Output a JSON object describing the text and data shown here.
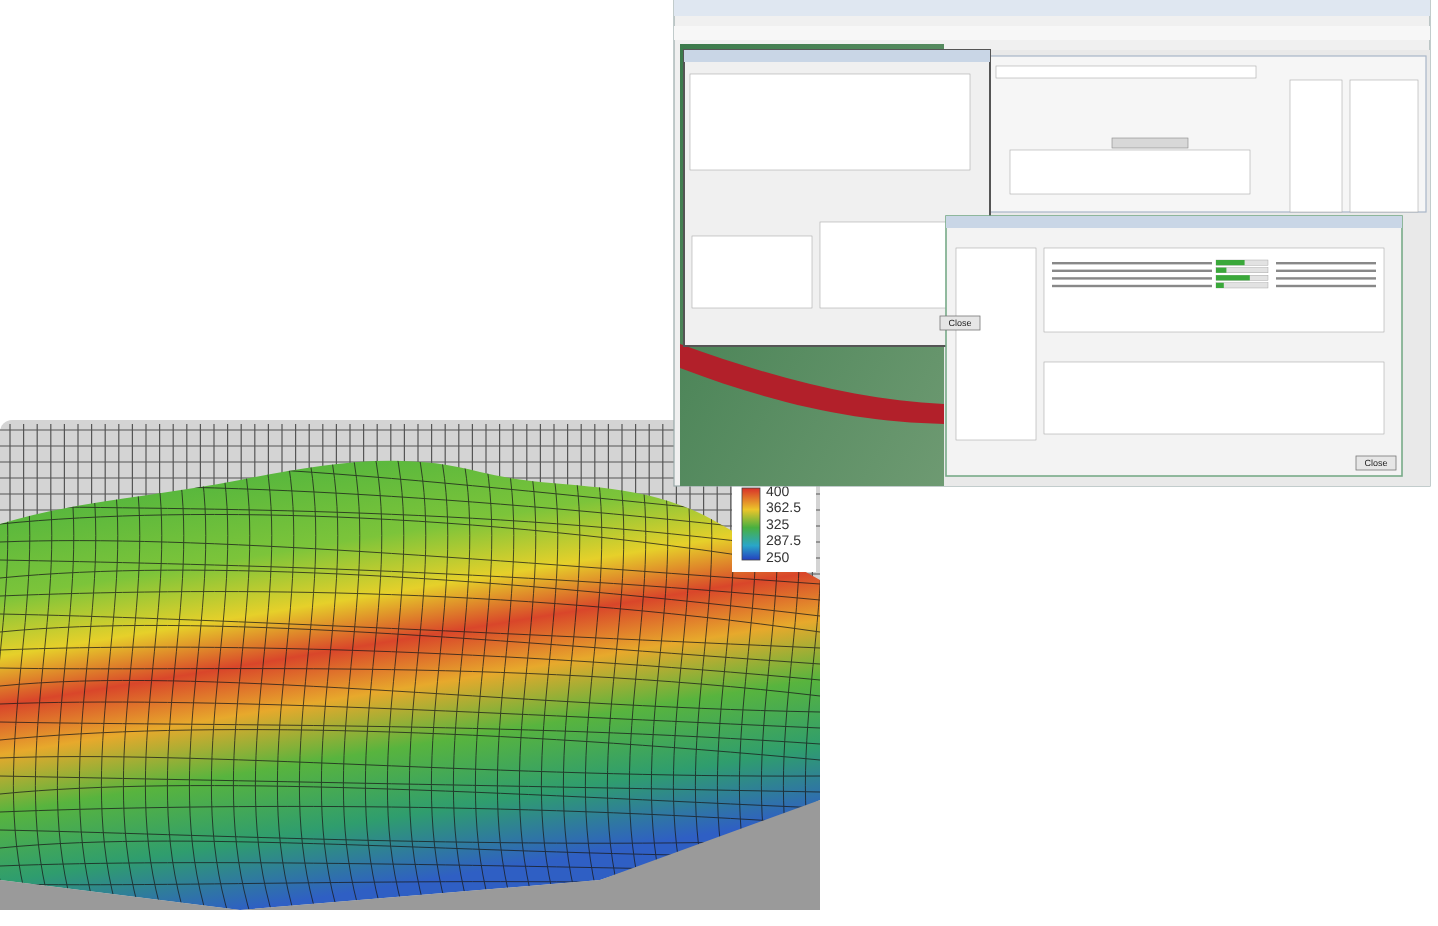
{
  "software_screenshot": {
    "dialog_buttons": [
      {
        "label": "Close"
      },
      {
        "label": "Close"
      }
    ],
    "jobs": [
      {
        "level": 0.55
      },
      {
        "level": 0.2
      },
      {
        "level": 0.65
      },
      {
        "level": 0.15
      }
    ]
  },
  "surface_plot": {
    "colorbar": {
      "ticks": [
        "400",
        "362.5",
        "325",
        "287.5",
        "250"
      ]
    }
  }
}
